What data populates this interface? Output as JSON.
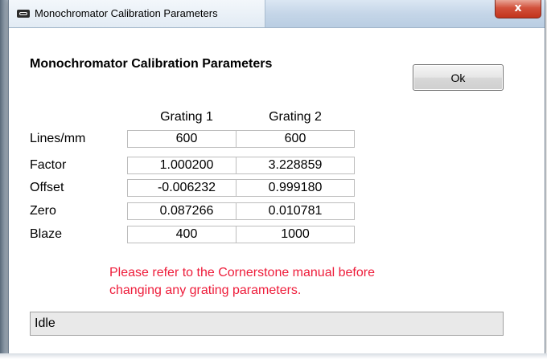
{
  "window": {
    "title": "Monochromator Calibration Parameters",
    "close_glyph": "x",
    "icon": "calibration-app-icon"
  },
  "dialog": {
    "heading": "Monochromator Calibration Parameters",
    "ok_label": "Ok"
  },
  "table": {
    "columns": [
      "Grating 1",
      "Grating 2"
    ],
    "rows": [
      {
        "label": "Lines/mm",
        "values": [
          "600",
          "600"
        ]
      },
      {
        "label": "Factor",
        "values": [
          "1.000200",
          "3.228859"
        ]
      },
      {
        "label": "Offset",
        "values": [
          "-0.006232",
          "0.999180"
        ]
      },
      {
        "label": "Zero",
        "values": [
          "0.087266",
          "0.010781"
        ]
      },
      {
        "label": "Blaze",
        "values": [
          "400",
          "1000"
        ]
      }
    ]
  },
  "warning": {
    "line1": "Please refer to the Cornerstone manual before",
    "line2": "changing any grating parameters.",
    "color": "#ee1c3a"
  },
  "status": {
    "text": "Idle"
  }
}
